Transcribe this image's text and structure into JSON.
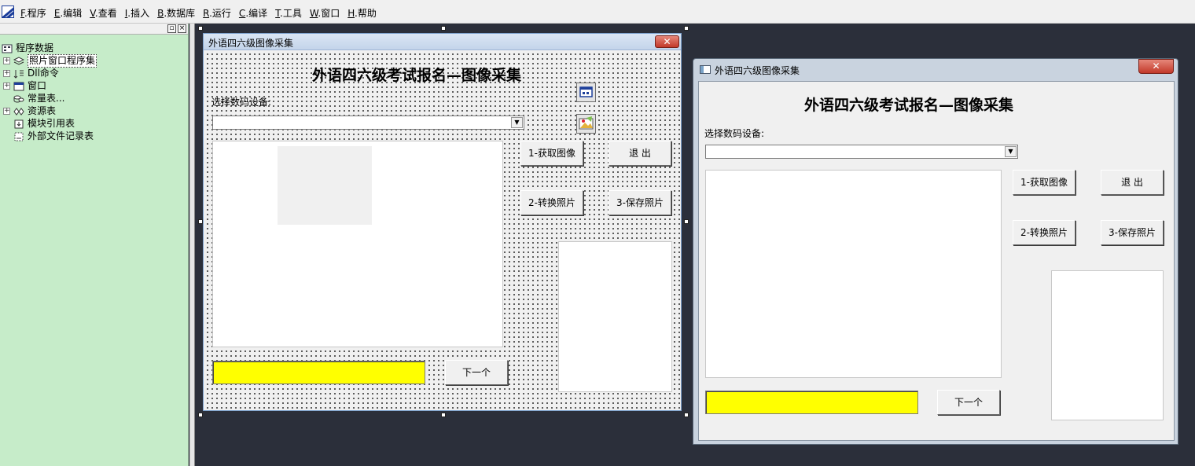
{
  "menu": [
    {
      "key": "F",
      "label": ".程序"
    },
    {
      "key": "E",
      "label": ".编辑"
    },
    {
      "key": "V",
      "label": ".查看"
    },
    {
      "key": "I",
      "label": ".插入"
    },
    {
      "key": "B",
      "label": ".数据库"
    },
    {
      "key": "R",
      "label": ".运行"
    },
    {
      "key": "C",
      "label": ".编译"
    },
    {
      "key": "T",
      "label": ".工具"
    },
    {
      "key": "W",
      "label": ".窗口"
    },
    {
      "key": "H",
      "label": ".帮助"
    }
  ],
  "tree": {
    "root": "程序数据",
    "items": [
      {
        "label": "照片窗口程序集",
        "icon": "module-icon"
      },
      {
        "label": "Dll命令",
        "icon": "dll-command-icon"
      },
      {
        "label": "窗口",
        "icon": "window-icon"
      },
      {
        "label": "常量表...",
        "icon": "constants-icon"
      },
      {
        "label": "资源表",
        "icon": "resource-icon"
      },
      {
        "label": "模块引用表",
        "icon": "module-ref-icon"
      },
      {
        "label": "外部文件记录表",
        "icon": "external-file-icon"
      }
    ]
  },
  "design_form": {
    "title": "外语四六级图像采集",
    "heading": "外语四六级考试报名—图像采集",
    "device_label": "选择数码设备:",
    "btn_capture": "1-获取图像",
    "btn_exit": "退  出",
    "btn_convert": "2-转换照片",
    "btn_save": "3-保存照片",
    "btn_next": "下一个"
  },
  "runtime_form": {
    "title": "外语四六级图像采集",
    "heading": "外语四六级考试报名—图像采集",
    "device_label": "选择数码设备:",
    "btn_capture": "1-获取图像",
    "btn_exit": "退  出",
    "btn_convert": "2-转换照片",
    "btn_save": "3-保存照片",
    "btn_next": "下一个"
  },
  "colors": {
    "tree_bg": "#c6ecc9",
    "workspace_bg": "#2b2f3a",
    "yellow_field": "#ffff00",
    "close_red": "#c2392a"
  }
}
